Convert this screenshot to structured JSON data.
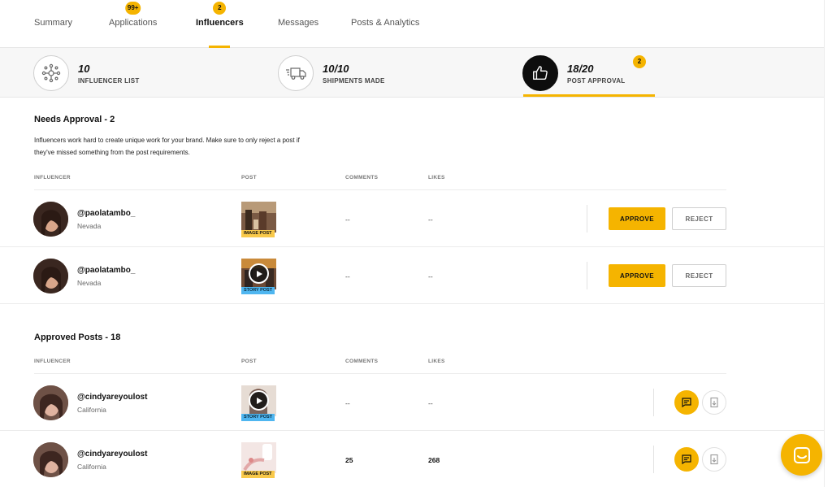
{
  "tabs": [
    {
      "label": "Summary",
      "badge": ""
    },
    {
      "label": "Applications",
      "badge": "99+"
    },
    {
      "label": "Influencers",
      "badge": "2",
      "active": true
    },
    {
      "label": "Messages",
      "badge": ""
    },
    {
      "label": "Posts & Analytics",
      "badge": ""
    }
  ],
  "stats": {
    "influencer_list": {
      "value": "10",
      "label": "INFLUENCER LIST",
      "icon": "network-icon"
    },
    "shipments": {
      "value": "10/10",
      "label": "SHIPMENTS MADE",
      "icon": "truck-icon"
    },
    "post_approval": {
      "value": "18/20",
      "label": "POST APPROVAL",
      "badge": "2",
      "icon": "thumbs-up-icon"
    }
  },
  "needs_approval": {
    "title": "Needs Approval - 2",
    "description": "Influencers work hard to create unique work for your brand. Make sure to only reject a post if they've missed something from the post requirements.",
    "columns": [
      "INFLUENCER",
      "POST",
      "COMMENTS",
      "LIKES"
    ],
    "rows": [
      {
        "handle": "@paolatambo_",
        "location": "Nevada",
        "post_type": "IMAGE POST",
        "comments": "--",
        "likes": "--",
        "approve": "APPROVE",
        "reject": "REJECT"
      },
      {
        "handle": "@paolatambo_",
        "location": "Nevada",
        "post_type": "STORY POST",
        "comments": "--",
        "likes": "--",
        "approve": "APPROVE",
        "reject": "REJECT"
      }
    ]
  },
  "approved_posts": {
    "title": "Approved Posts - 18",
    "columns": [
      "INFLUENCER",
      "POST",
      "COMMENTS",
      "LIKES"
    ],
    "rows": [
      {
        "handle": "@cindyareyoulost",
        "location": "California",
        "post_type": "STORY POST",
        "comments": "--",
        "likes": "--"
      },
      {
        "handle": "@cindyareyoulost",
        "location": "California",
        "post_type": "IMAGE POST",
        "comments": "25",
        "likes": "268"
      }
    ]
  },
  "colors": {
    "accent": "#f5b400",
    "story_tag": "#4fb6f0",
    "image_tag": "#f9c94a"
  }
}
